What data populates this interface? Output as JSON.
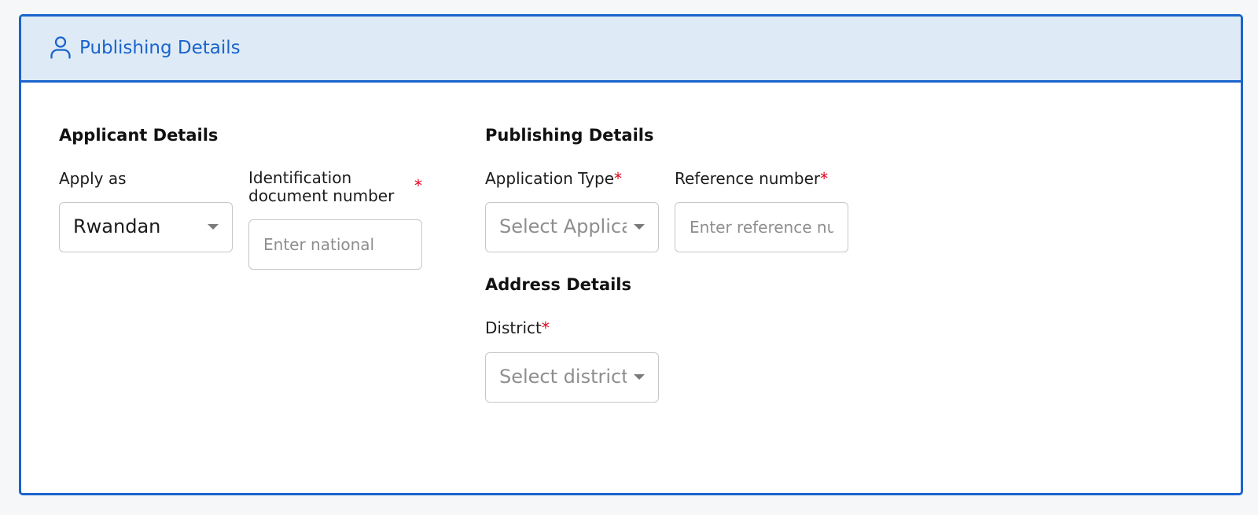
{
  "header": {
    "icon": "user-icon",
    "title": "Publishing Details",
    "accent_color": "#1a64cc",
    "background_color": "#deebf7"
  },
  "applicant_section": {
    "title": "Applicant Details",
    "apply_as": {
      "label": "Apply as",
      "selected_value": "Rwandan"
    },
    "identification": {
      "label": "Identification document number",
      "required_marker": "*",
      "placeholder": "Enter national"
    }
  },
  "publishing_section": {
    "title": "Publishing Details",
    "application_type": {
      "label": "Application Type",
      "required_marker": "*",
      "placeholder": "Select Applica"
    },
    "reference_number": {
      "label": "Reference number",
      "required_marker": "*",
      "placeholder": "Enter reference nu"
    }
  },
  "address_section": {
    "title": "Address Details",
    "district": {
      "label": "District",
      "required_marker": "*",
      "placeholder": "Select district"
    }
  },
  "required_color": "#e0001b"
}
